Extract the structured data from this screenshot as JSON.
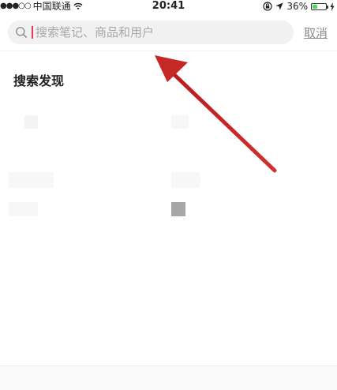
{
  "status_bar": {
    "signal": "●●●○○",
    "carrier": "中国联通",
    "time": "20:41",
    "battery_percent": "36%",
    "battery_level": 0.36
  },
  "search": {
    "placeholder": "搜索笔记、商品和用户",
    "value": "",
    "cancel_label": "取消"
  },
  "discover": {
    "title": "搜索发现"
  },
  "colors": {
    "caret": "#e8375a",
    "annotation_arrow": "#c62828",
    "battery": "#4cd964"
  },
  "icons": [
    "search-icon",
    "wifi-icon",
    "lock-rotation-icon",
    "location-icon",
    "battery-icon",
    "charging-bolt-icon"
  ]
}
